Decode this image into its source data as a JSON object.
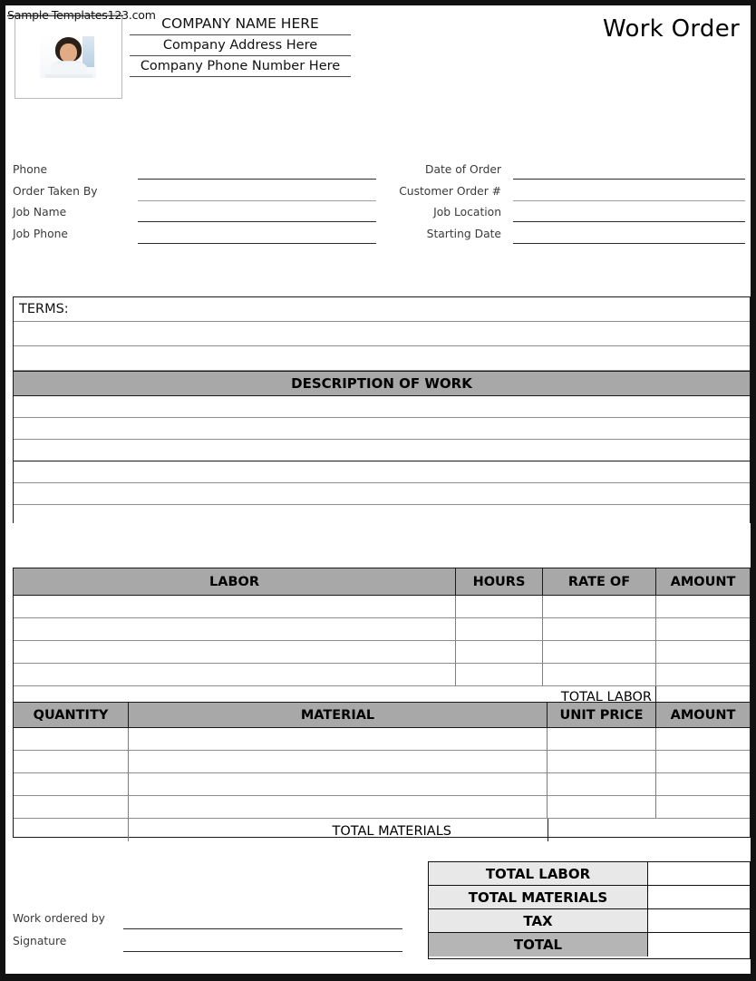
{
  "watermark": "Sample-Templates123.com",
  "header": {
    "logo_alt": "company-logo-placeholder",
    "company_name": "COMPANY NAME HERE",
    "company_address": "Company Address Here",
    "company_phone": "Company Phone Number Here",
    "doc_title": "Work Order"
  },
  "fields": {
    "left": [
      {
        "label": "Phone",
        "value": ""
      },
      {
        "label": "Order Taken By",
        "value": ""
      },
      {
        "label": "Job Name",
        "value": ""
      },
      {
        "label": "Job Phone",
        "value": ""
      }
    ],
    "right": [
      {
        "label": "Date of Order",
        "value": ""
      },
      {
        "label": "Customer Order #",
        "value": ""
      },
      {
        "label": "Job Location",
        "value": ""
      },
      {
        "label": "Starting Date",
        "value": ""
      }
    ]
  },
  "terms": {
    "label": "TERMS:",
    "blank_rows": 2
  },
  "description": {
    "header": "DESCRIPTION OF WORK",
    "blank_rows": 6
  },
  "labor_table": {
    "columns": [
      "LABOR",
      "HOURS",
      "RATE OF",
      "AMOUNT"
    ],
    "blank_rows": 4,
    "total_label": "TOTAL LABOR",
    "total_value": ""
  },
  "material_table": {
    "columns": [
      "QUANTITY",
      "MATERIAL",
      "UNIT PRICE",
      "AMOUNT"
    ],
    "blank_rows": 4,
    "total_label": "TOTAL MATERIALS",
    "total_value": ""
  },
  "totals": [
    {
      "label": "TOTAL LABOR",
      "value": ""
    },
    {
      "label": "TOTAL MATERIALS",
      "value": ""
    },
    {
      "label": "TAX",
      "value": ""
    },
    {
      "label": "TOTAL",
      "value": ""
    }
  ],
  "signature": {
    "rows": [
      {
        "label": "Work ordered by",
        "value": ""
      },
      {
        "label": "Signature",
        "value": ""
      }
    ]
  },
  "colors": {
    "header_gray": "#a8a8a8",
    "totals_light": "#e8e8e8",
    "totals_dark": "#b5b5b5",
    "border_dark": "#1a1a1a",
    "page_frame": "#111111"
  }
}
